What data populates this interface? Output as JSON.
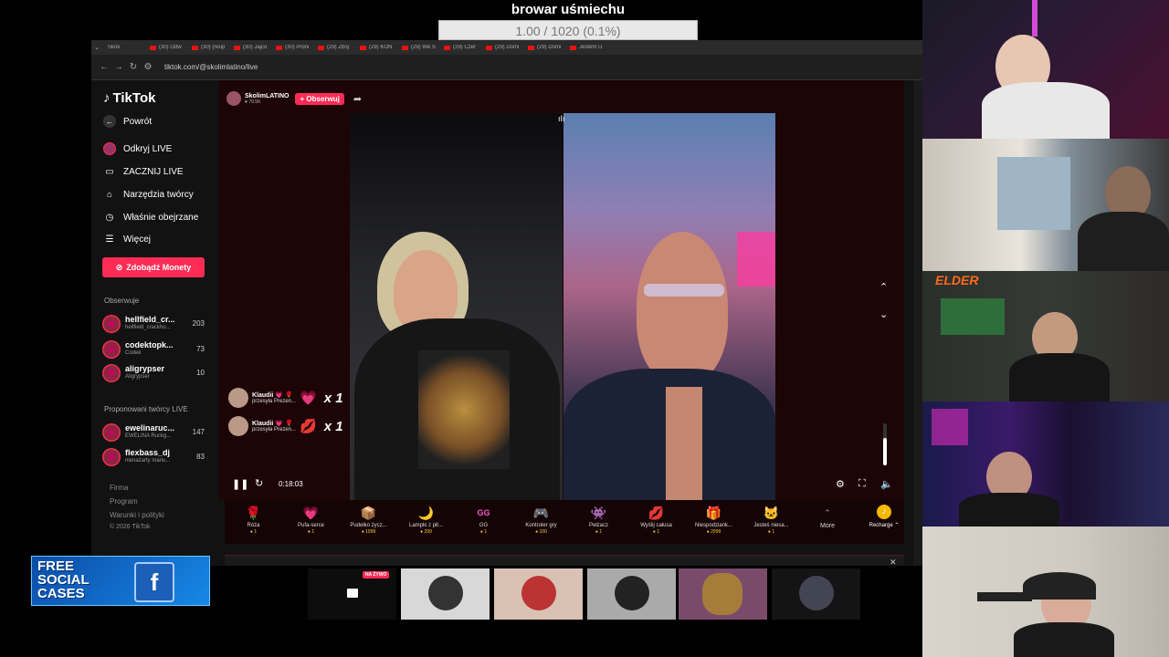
{
  "overlay": {
    "title": "browar uśmiechu",
    "progress": "1.00 / 1020 (0.1%)"
  },
  "browser": {
    "tabs": [
      "Skoli",
      "(30) Odw",
      "(30) (reup",
      "(30) Jajco",
      "(30) Proni",
      "(29) Zboj",
      "(29) KON",
      "(29) We S",
      "(29) Czer",
      "(29) Domi",
      "(29) Domi",
      "Jestem U"
    ],
    "url": "tiktok.com/@skolimlatino/live"
  },
  "sidebar": {
    "logo": "TikTok",
    "back": "Powrót",
    "nav": [
      "Odkryj LIVE",
      "ZACZNIJ LIVE",
      "Narzędzia twórcy",
      "Właśnie obejrzane",
      "Więcej"
    ],
    "coins_btn": "Zdobądź Monety",
    "following_title": "Obserwuje",
    "following": [
      {
        "name": "hellfield_cr...",
        "sub": "hellfield_crackho...",
        "count": "203"
      },
      {
        "name": "codektopk...",
        "sub": "Codek",
        "count": "73"
      },
      {
        "name": "aligrypser",
        "sub": "Aligrypser",
        "count": "10"
      }
    ],
    "suggested_title": "Proponowani twórcy LIVE",
    "suggested": [
      {
        "name": "ewelinaruc...",
        "sub": "EWELINA Ruckg...",
        "count": "147"
      },
      {
        "name": "flexbass_dj",
        "sub": "nienażarty mariu...",
        "count": "83"
      }
    ],
    "footer": [
      "Firma",
      "Program",
      "Warunki i polityki",
      "© 2026 TikTok"
    ]
  },
  "live": {
    "host": "SkolimLATINO",
    "viewers": "♥ 79.5K",
    "follow": "+ Obserwuj",
    "time": "0:18:03",
    "gift_popups": [
      {
        "user": "Klaudii 💗 🌹",
        "text": "przesyła Prezen...",
        "icon": "💗",
        "mult": "x 1"
      },
      {
        "user": "Klaudii 💗 🌹",
        "text": "przesyła Prezen...",
        "icon": "💋",
        "mult": "x 1"
      }
    ]
  },
  "gifts": [
    {
      "icon": "🌹",
      "name": "Róża",
      "price": "1"
    },
    {
      "icon": "💗",
      "name": "Pufa-serce",
      "price": "1"
    },
    {
      "icon": "📦",
      "name": "Pudełko życz...",
      "price": "1999"
    },
    {
      "icon": "🌙",
      "name": "Lampki z płt...",
      "price": "299"
    },
    {
      "icon": "GG",
      "name": "GG",
      "price": "1"
    },
    {
      "icon": "🎮",
      "name": "Kontroler gry",
      "price": "100"
    },
    {
      "icon": "👾",
      "name": "Pełzacz",
      "price": "1"
    },
    {
      "icon": "💋",
      "name": "Wyślij całusa",
      "price": "1"
    },
    {
      "icon": "🎁",
      "name": "Niespodziank...",
      "price": "2999"
    },
    {
      "icon": "🐱",
      "name": "Jesteś niesa...",
      "price": "1"
    }
  ],
  "gifts_more": "More",
  "recharge": "Recharge",
  "bottom": {
    "live_badge": "NA ŻYWO"
  },
  "social": {
    "line1": "FREE",
    "line2": "SOCIAL",
    "line3": "CASES"
  },
  "cams": {
    "third_label": "ELDER"
  }
}
